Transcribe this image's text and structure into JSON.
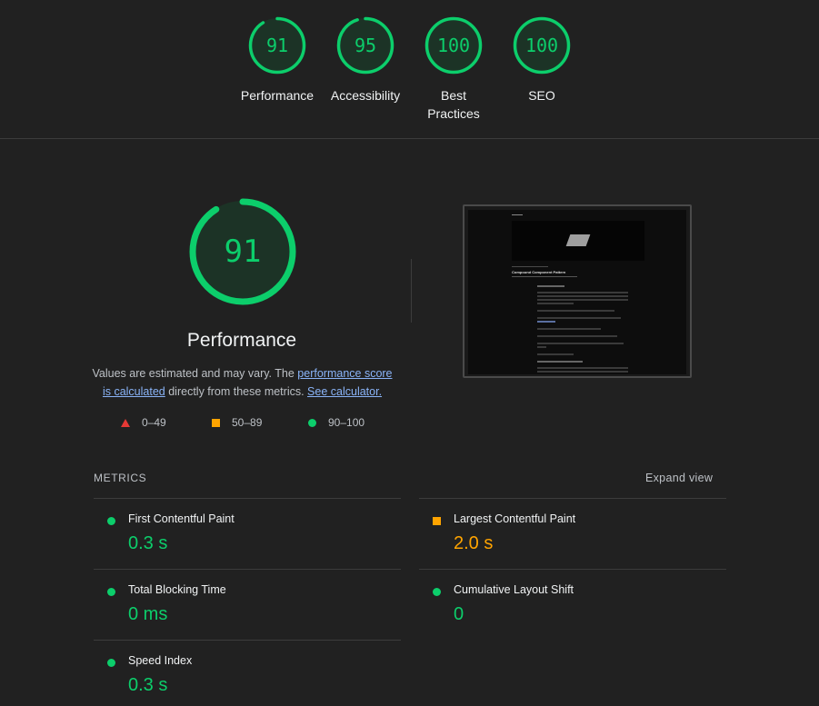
{
  "top_scores": [
    {
      "score": "91",
      "label": "Performance",
      "pct": 0.91
    },
    {
      "score": "95",
      "label": "Accessibility",
      "pct": 0.95
    },
    {
      "score": "100",
      "label": "Best Practices",
      "pct": 1.0
    },
    {
      "score": "100",
      "label": "SEO",
      "pct": 1.0
    }
  ],
  "main": {
    "score": "91",
    "pct": 0.91,
    "title": "Performance",
    "desc_prefix": "Values are estimated and may vary. The ",
    "desc_link1": "performance score is calculated",
    "desc_mid": " directly from these metrics. ",
    "desc_link2": "See calculator."
  },
  "legend": {
    "fail": "0–49",
    "average": "50–89",
    "pass": "90–100"
  },
  "thumbnail": {
    "title": "Compound Component Pattern"
  },
  "metrics": {
    "header": "METRICS",
    "expand_label": "Expand view",
    "items": [
      {
        "name": "First Contentful Paint",
        "value": "0.3 s",
        "status": "pass"
      },
      {
        "name": "Largest Contentful Paint",
        "value": "2.0 s",
        "status": "average"
      },
      {
        "name": "Total Blocking Time",
        "value": "0 ms",
        "status": "pass"
      },
      {
        "name": "Cumulative Layout Shift",
        "value": "0",
        "status": "pass"
      },
      {
        "name": "Speed Index",
        "value": "0.3 s",
        "status": "pass"
      }
    ]
  },
  "colors": {
    "pass": "#0cce6b",
    "average": "#ffa400",
    "fail": "#e53935",
    "link": "#8ab4f8",
    "background": "#212121"
  }
}
